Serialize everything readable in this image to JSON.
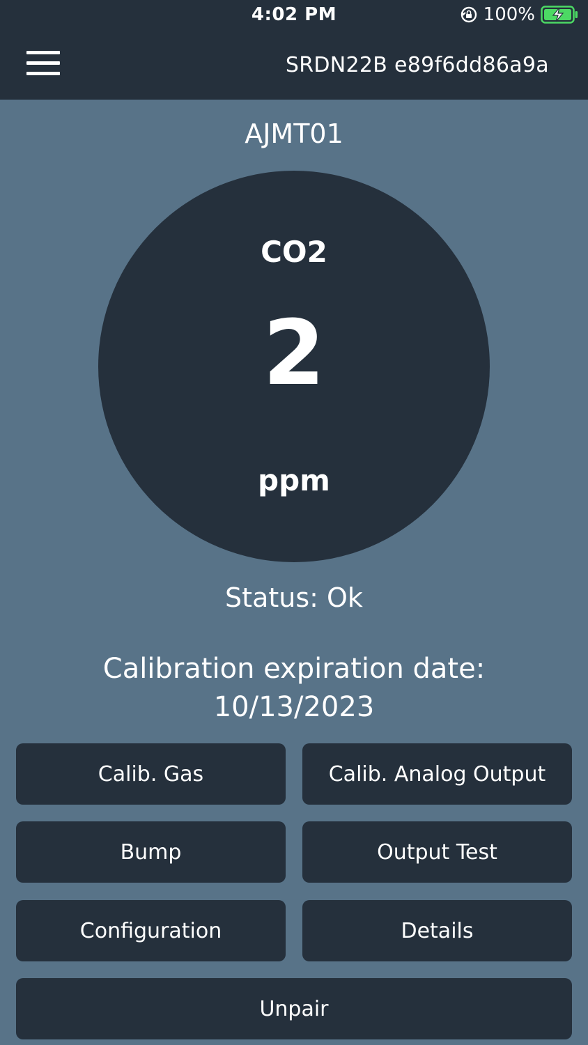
{
  "status_bar": {
    "time": "4:02 PM",
    "battery": "100%",
    "icons": [
      "rotation-lock-icon",
      "battery-charging-icon"
    ]
  },
  "header": {
    "menu_icon": "hamburger-menu-icon",
    "device_id": "SRDN22B e89f6dd86a9a"
  },
  "sensor": {
    "name": "AJMT01",
    "gas": "CO2",
    "value": "2",
    "unit": "ppm",
    "status": "Status: Ok",
    "calibration_label": "Calibration expiration date:",
    "calibration_date": "10/13/2023"
  },
  "buttons": {
    "calib_gas": "Calib. Gas",
    "calib_analog_output": "Calib. Analog Output",
    "bump": "Bump",
    "output_test": "Output Test",
    "configuration": "Configuration",
    "details": "Details",
    "unpair": "Unpair"
  },
  "colors": {
    "header_bg": "#25303c",
    "page_bg": "#587388",
    "panel_bg": "#25303c",
    "battery_green": "#4cd964"
  }
}
